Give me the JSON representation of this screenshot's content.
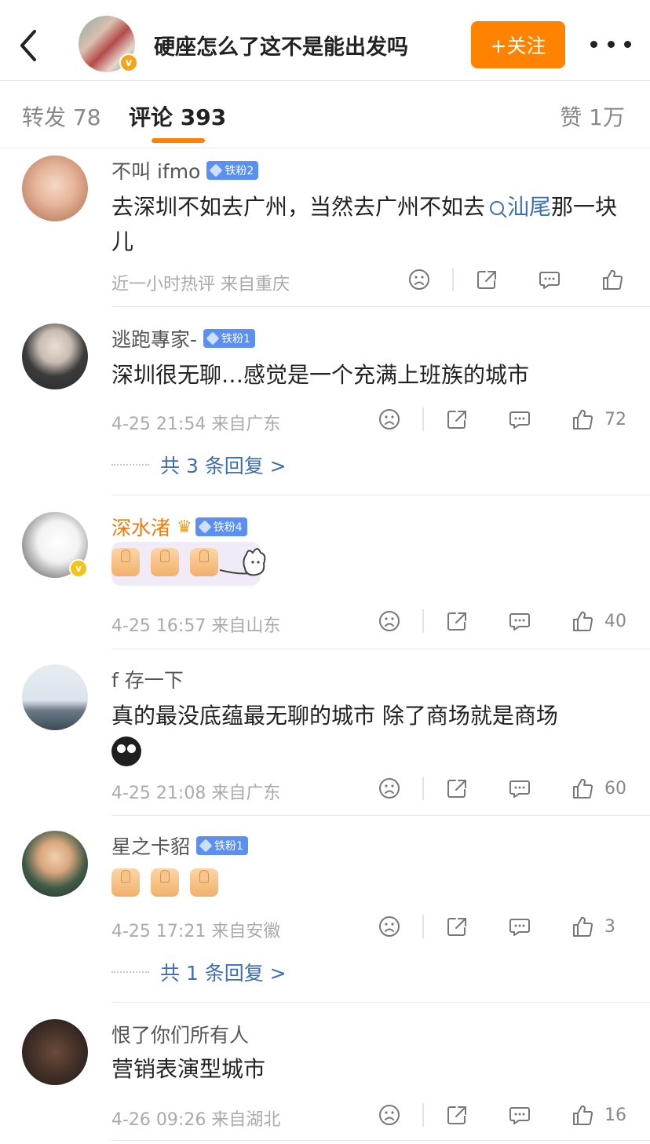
{
  "header": {
    "title": "硬座怎么了这不是能出发吗",
    "follow_label": "+关注",
    "back_icon": "chevron-left-icon",
    "more_icon": "more-dots-icon",
    "verified_badge": "v"
  },
  "tabs": {
    "repost": "转发 78",
    "comment": "评论 393",
    "like": "赞 1万",
    "accent": "#ff8200"
  },
  "comments": [
    {
      "name": "不叫 ifmo",
      "fan_badge": "铁粉2",
      "text_before": "去深圳不如去广州，当然去广州不如去",
      "link": "汕尾",
      "text_after": "那一块儿",
      "meta": "近一小时热评  来自重庆",
      "likes": ""
    },
    {
      "name": "逃跑專家-",
      "fan_badge": "铁粉1",
      "text": "深圳很无聊…感觉是一个充满上班族的城市",
      "meta": "4-25 21:54  来自广东",
      "likes": "72",
      "replies": "共 3 条回复 >"
    },
    {
      "name": "深水渚",
      "fan_badge": "铁粉4",
      "verified_badge": "v",
      "meta": "4-25 16:57  来自山东",
      "likes": "40"
    },
    {
      "name": "f 存一下",
      "text": "真的最没底蕴最无聊的城市 除了商场就是商场",
      "meta": "4-25 21:08  来自广东",
      "likes": "60"
    },
    {
      "name": "星之卡貂",
      "fan_badge": "铁粉1",
      "meta": "4-25 17:21  来自安徽",
      "likes": "3",
      "replies": "共 1 条回复 >"
    },
    {
      "name": "恨了你们所有人",
      "text": "营销表演型城市",
      "meta": "4-26 09:26  来自湖北",
      "likes": "16"
    }
  ],
  "icons": {
    "dislike": "sad-face-icon",
    "share": "share-icon",
    "reply": "comment-icon",
    "like": "thumbs-up-icon"
  }
}
